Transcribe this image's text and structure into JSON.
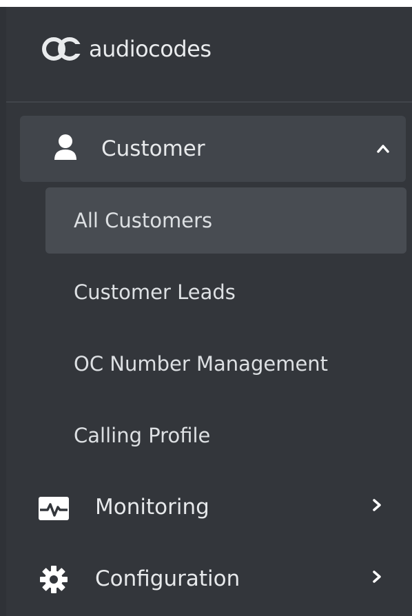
{
  "brand": {
    "logo_text": "audiocodes"
  },
  "nav": {
    "customer": {
      "label": "Customer",
      "icon": "user-icon",
      "expanded": true,
      "children": [
        {
          "label": "All Customers",
          "active": true
        },
        {
          "label": "Customer Leads",
          "active": false
        },
        {
          "label": "OC Number Management",
          "active": false
        },
        {
          "label": "Calling Profile",
          "active": false
        }
      ]
    },
    "monitoring": {
      "label": "Monitoring",
      "icon": "heartbeat-icon"
    },
    "configuration": {
      "label": "Configuration",
      "icon": "gear-icon"
    }
  },
  "colors": {
    "sidebar_bg": "#33363b",
    "group_bg": "#41454b",
    "active_bg": "#484c52",
    "text": "#e7e9eb"
  }
}
